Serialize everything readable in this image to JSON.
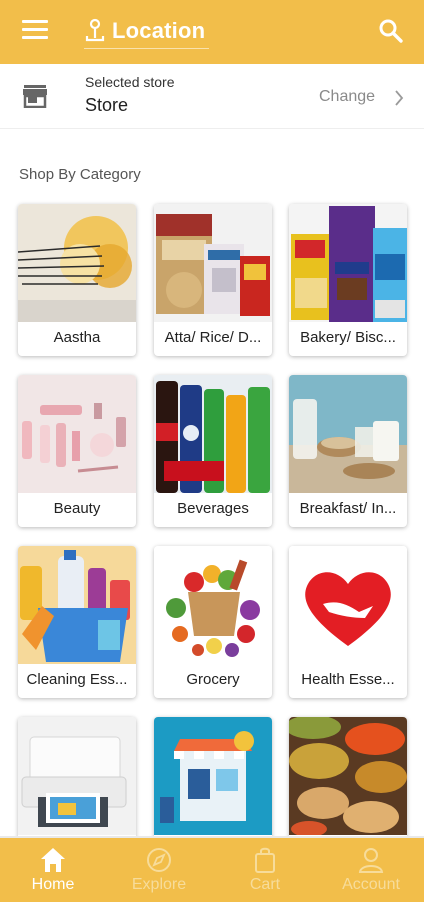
{
  "header": {
    "title": "Location",
    "menu_icon": "hamburger-menu-icon",
    "search_icon": "search-icon",
    "background": "#f2be4a"
  },
  "store": {
    "subtitle": "Selected store",
    "name": "Store",
    "change_label": "Change"
  },
  "section_title": "Shop By Category",
  "categories": [
    {
      "label": "Aastha"
    },
    {
      "label": "Atta/ Rice/ D..."
    },
    {
      "label": "Bakery/ Bisc..."
    },
    {
      "label": "Beauty"
    },
    {
      "label": "Beverages"
    },
    {
      "label": "Breakfast/ In..."
    },
    {
      "label": "Cleaning Ess..."
    },
    {
      "label": "Grocery"
    },
    {
      "label": "Health Esse..."
    },
    {
      "label": ""
    },
    {
      "label": ""
    },
    {
      "label": ""
    }
  ],
  "bottom_nav": [
    {
      "label": "Home",
      "icon": "home-icon",
      "active": true
    },
    {
      "label": "Explore",
      "icon": "compass-icon",
      "active": false
    },
    {
      "label": "Cart",
      "icon": "shopping-bag-icon",
      "active": false
    },
    {
      "label": "Account",
      "icon": "person-icon",
      "active": false
    }
  ]
}
